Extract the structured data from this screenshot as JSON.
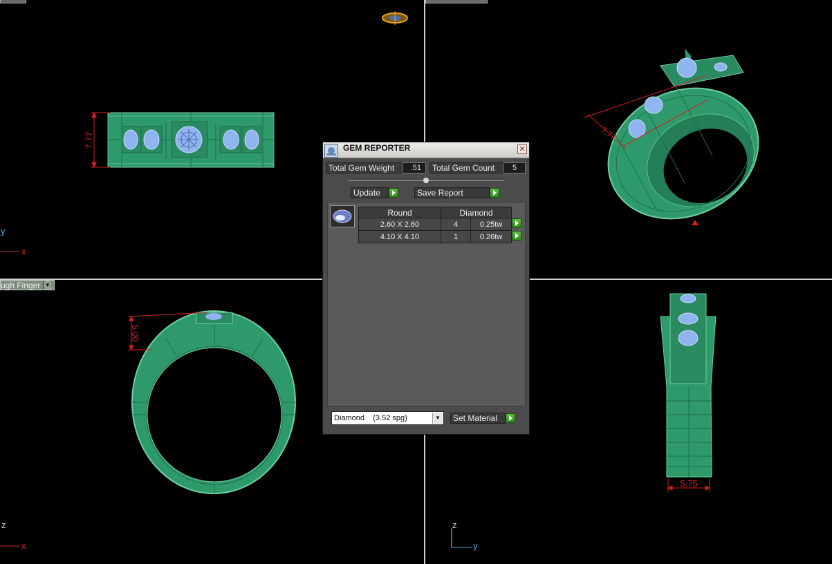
{
  "viewports": {
    "bottom_left_label": "ugh Finger",
    "front": {
      "dimension": "7.77",
      "axis_y": "y",
      "axis_x": "x"
    },
    "side": {
      "dimension": "5.00",
      "axis_z": "z",
      "axis_x": "x"
    },
    "top": {
      "dimension": "5.75",
      "axis_z": "z",
      "axis_y": "y"
    }
  },
  "dialog": {
    "title": "GEM REPORTER",
    "close_glyph": "✕",
    "total_weight_label": "Total Gem Weight",
    "total_weight_value": ".51",
    "total_count_label": "Total Gem Count",
    "total_count_value": "5",
    "update_label": "Update",
    "save_report_label": "Save Report",
    "table": {
      "headers": [
        "Round",
        "Diamond"
      ],
      "rows": [
        {
          "size": "2.60 X 2.60",
          "count": "4",
          "weight": "0.25tw"
        },
        {
          "size": "4.10 X 4.10",
          "count": "1",
          "weight": "0.26tw"
        }
      ]
    },
    "material_select": "Diamond    (3.52 spg)",
    "set_material_label": "Set Material"
  },
  "colors": {
    "ring_green": "#2e9a6c",
    "gem_blue": "#8fb4f0",
    "dimension_red": "#d02020",
    "dialog_bg": "#4b4b4b"
  }
}
